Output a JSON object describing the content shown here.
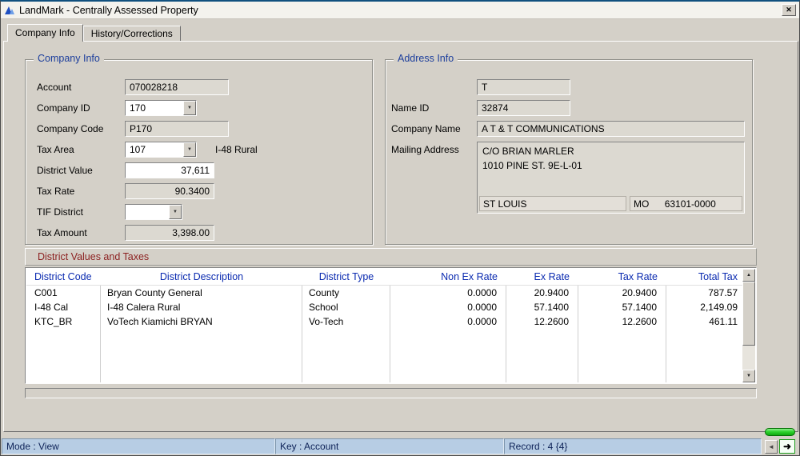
{
  "window": {
    "title": "LandMark - Centrally Assessed Property"
  },
  "icons": {
    "close": "✕",
    "dropdown": "▼",
    "scroll_up": "▲",
    "scroll_down": "▼",
    "nav_prev": "◄",
    "nav_next": "➜"
  },
  "tabs": {
    "company_info": "Company Info",
    "history": "History/Corrections"
  },
  "company_info": {
    "legend": "Company Info",
    "account_label": "Account",
    "account_value": "070028218",
    "company_id_label": "Company ID",
    "company_id_value": "170",
    "company_code_label": "Company Code",
    "company_code_value": "P170",
    "tax_area_label": "Tax Area",
    "tax_area_value": "107",
    "tax_area_name": "I-48 Rural",
    "district_value_label": "District Value",
    "district_value_value": "37,611",
    "tax_rate_label": "Tax Rate",
    "tax_rate_value": "90.3400",
    "tif_label": "TIF District",
    "tif_value": "",
    "tax_amount_label": "Tax Amount",
    "tax_amount_value": "3,398.00"
  },
  "address_info": {
    "legend": "Address Info",
    "type_value": "T",
    "name_id_label": "Name ID",
    "name_id_value": "32874",
    "company_name_label": "Company Name",
    "company_name_value": "A T & T COMMUNICATIONS",
    "mailing_label": "Mailing Address",
    "address_line1": "C/O BRIAN MARLER",
    "address_line2": "1010 PINE ST. 9E-L-01",
    "city": "ST LOUIS",
    "state": "MO",
    "zip": "63101-0000"
  },
  "districts": {
    "section_title": "District Values and Taxes",
    "columns": [
      "District Code",
      "District Description",
      "District Type",
      "Non Ex Rate",
      "Ex Rate",
      "Tax Rate",
      "Total Tax"
    ],
    "rows": [
      [
        "C001",
        "Bryan County General",
        "County",
        "0.0000",
        "20.9400",
        "20.9400",
        "787.57"
      ],
      [
        "I-48 Cal",
        "I-48 Calera Rural",
        "School",
        "0.0000",
        "57.1400",
        "57.1400",
        "2,149.09"
      ],
      [
        "KTC_BR",
        "VoTech Kiamichi BRYAN",
        "Vo-Tech",
        "0.0000",
        "12.2600",
        "12.2600",
        "461.11"
      ]
    ]
  },
  "status": {
    "mode": "Mode : View",
    "key": "Key : Account",
    "record": "Record : 4 {4}"
  }
}
